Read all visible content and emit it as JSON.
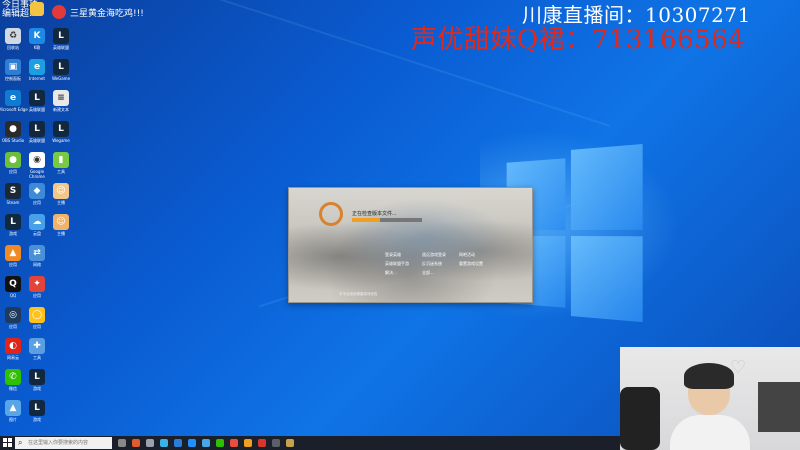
{
  "overlay": {
    "room_line": "川康直播间：10307271",
    "group_line": "声优甜妹Q裙：713166564"
  },
  "notice": {
    "line1": "今日事项",
    "line2": "编辑超...",
    "line3": "三星黄金海吃鸡!!!"
  },
  "desktop_icons": [
    {
      "name": "recycle-bin-icon",
      "label": "回收站",
      "color": "#cfd8e3",
      "glyph": "♻"
    },
    {
      "name": "k-app-icon",
      "label": "K歌",
      "color": "#1e88e5",
      "glyph": "K"
    },
    {
      "name": "game-launcher-icon",
      "label": "英雄联盟",
      "color": "#12283e",
      "glyph": "L"
    },
    {
      "name": "control-panel-icon",
      "label": "控制面板",
      "color": "#2d7dd2",
      "glyph": "▣"
    },
    {
      "name": "ie-icon",
      "label": "Internet",
      "color": "#1a9fe0",
      "glyph": "e"
    },
    {
      "name": "game-icon-2",
      "label": "WeGame",
      "color": "#12283e",
      "glyph": "L"
    },
    {
      "name": "edge-icon",
      "label": "Microsoft Edge",
      "color": "#0f7bd1",
      "glyph": "e"
    },
    {
      "name": "game-icon-3",
      "label": "英雄联盟",
      "color": "#12283e",
      "glyph": "L"
    },
    {
      "name": "file-icon",
      "label": "新建文本",
      "color": "#e8e8e8",
      "glyph": "≡"
    },
    {
      "name": "obs-icon",
      "label": "OBS Studio",
      "color": "#2b2b2b",
      "glyph": "●"
    },
    {
      "name": "game-icon-4",
      "label": "英雄联盟",
      "color": "#12283e",
      "glyph": "L"
    },
    {
      "name": "game-icon-5",
      "label": "Wegame",
      "color": "#12283e",
      "glyph": "L"
    },
    {
      "name": "app-green-icon",
      "label": "应用",
      "color": "#6bbf3a",
      "glyph": "●"
    },
    {
      "name": "chrome-icon",
      "label": "Google Chrome",
      "color": "#ffffff",
      "glyph": "◉"
    },
    {
      "name": "bar-icon",
      "label": "工具",
      "color": "#7ac943",
      "glyph": "▮"
    },
    {
      "name": "steam-icon",
      "label": "Steam",
      "color": "#1b2838",
      "glyph": "S"
    },
    {
      "name": "app-blue-icon",
      "label": "应用",
      "color": "#3c8ad8",
      "glyph": "◆"
    },
    {
      "name": "app-char-icon",
      "label": "主播",
      "color": "#f3c78b",
      "glyph": "☺"
    },
    {
      "name": "game-icon-6",
      "label": "游戏",
      "color": "#12283e",
      "glyph": "L"
    },
    {
      "name": "cloud-icon",
      "label": "云盘",
      "color": "#47a0e8",
      "glyph": "☁"
    },
    {
      "name": "app-char2-icon",
      "label": "主播",
      "color": "#f1b36c",
      "glyph": "☺"
    },
    {
      "name": "app-orange-icon",
      "label": "应用",
      "color": "#f08a24",
      "glyph": "▲"
    },
    {
      "name": "network-icon",
      "label": "网络",
      "color": "#4a90d9",
      "glyph": "⇄"
    },
    {
      "name": "qq-icon",
      "label": "QQ",
      "color": "#111111",
      "glyph": "Q"
    },
    {
      "name": "app-red-icon",
      "label": "应用",
      "color": "#e2443a",
      "glyph": "✦"
    },
    {
      "name": "app-dark-icon",
      "label": "应用",
      "color": "#1f3a5a",
      "glyph": "◎"
    },
    {
      "name": "app-yellow-icon",
      "label": "应用",
      "color": "#ffc21a",
      "glyph": "◯"
    },
    {
      "name": "netease-icon",
      "label": "网易云",
      "color": "#e2231a",
      "glyph": "◐"
    },
    {
      "name": "app-tool-icon",
      "label": "工具",
      "color": "#5aa0e0",
      "glyph": "✚"
    },
    {
      "name": "wechat-icon",
      "label": "微信",
      "color": "#2dc100",
      "glyph": "✆"
    },
    {
      "name": "game-icon-7",
      "label": "游戏",
      "color": "#12283e",
      "glyph": "L"
    },
    {
      "name": "photo-icon",
      "label": "图片",
      "color": "#58a6e8",
      "glyph": "▲"
    },
    {
      "name": "game-icon-8",
      "label": "游戏",
      "color": "#12283e",
      "glyph": "L"
    }
  ],
  "launcher": {
    "status": "正在检查版本文件...",
    "progress": 0.4,
    "menu": [
      "登录英雄",
      "遥远游戏登录",
      "网吧活动",
      "英雄联盟手游",
      "反沉迷系统",
      "重置游戏设置",
      "解决...",
      "全部..."
    ],
    "footer": "本平台适用健康游戏忠告"
  },
  "taskbar": {
    "search_placeholder": "在这里输入你要搜索的内容"
  }
}
